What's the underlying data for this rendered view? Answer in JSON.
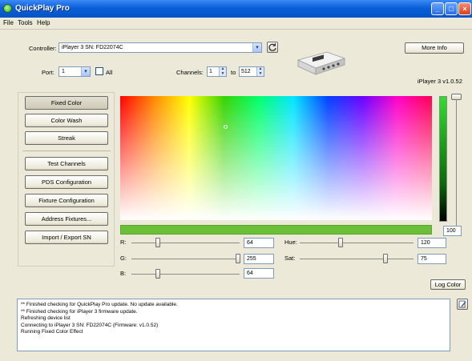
{
  "window": {
    "title": "QuickPlay Pro"
  },
  "menu": [
    "File",
    "Tools",
    "Help"
  ],
  "controller": {
    "label": "Controller:",
    "value": "iPlayer 3 SN: FD22074C"
  },
  "port": {
    "label": "Port:",
    "value": "1",
    "all_label": "All",
    "all_checked": false
  },
  "channels": {
    "label": "Channels:",
    "from": "1",
    "to_label": "to",
    "to": "512"
  },
  "more_info_label": "More Info",
  "device_version": "iPlayer 3 v1.0.52",
  "sidebar": {
    "group1": [
      "Fixed Color",
      "Color Wash",
      "Streak"
    ],
    "group2": [
      "Test Channels",
      "PDS Configuration",
      "Fixture Configuration",
      "Address Fixtures...",
      "Import / Export SN"
    ],
    "active": "Fixed Color"
  },
  "color": {
    "current_hex": "#40FF40",
    "intensity": "100",
    "r_label": "R:",
    "r": "64",
    "g_label": "G:",
    "g": "255",
    "b_label": "B:",
    "b": "64",
    "hue_label": "Hue:",
    "hue": "120",
    "sat_label": "Sat:",
    "sat": "75",
    "intensity_value": 1.0,
    "picker_hue_fraction": 0.34,
    "picker_sat_fraction": 0.75
  },
  "log_color_label": "Log Color",
  "log": [
    "** Finished checking for QuickPlay Pro update. No update available.",
    "** Finished checking for iPlayer 3 firmware update.",
    "Refreshing device list",
    "Connecting to iPlayer 3 SN: FD22074C (Firmware: v1.0.52)",
    "Running Fixed Color Effect"
  ],
  "icons": {
    "app": "quickplay-app-icon",
    "refresh": "refresh-icon",
    "device": "iplayer-device-icon",
    "clear_log": "clear-log-icon"
  }
}
